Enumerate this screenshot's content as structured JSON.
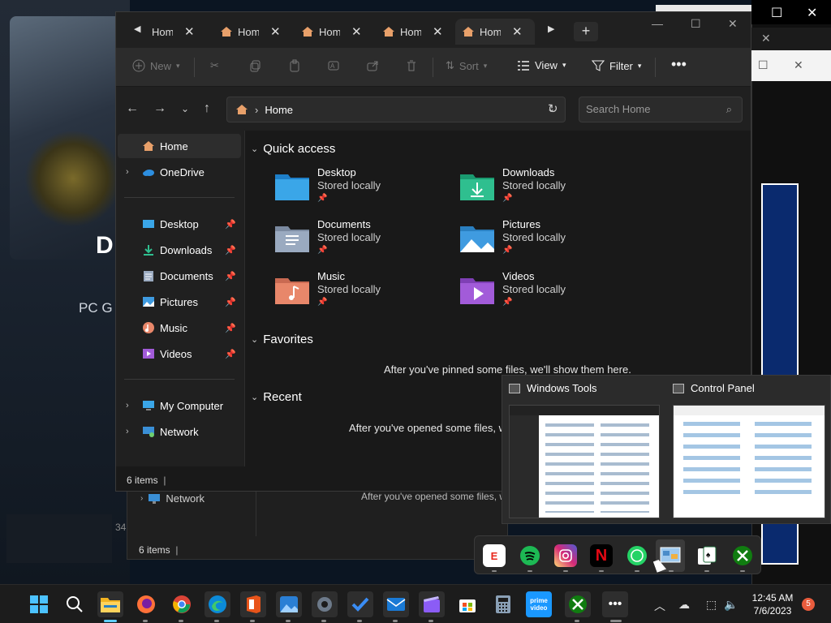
{
  "background": {
    "hero_letter": "D",
    "hero_subtitle": "PC G",
    "hero_counter": "34",
    "ghost_nav_item": "Network",
    "ghost_empty_msg": "After you've opened some files, w",
    "ghost_status": "6 items"
  },
  "explorer": {
    "tabs": [
      {
        "label": "Hom",
        "active": false
      },
      {
        "label": "Hom",
        "active": false
      },
      {
        "label": "Hom",
        "active": false
      },
      {
        "label": "Hom",
        "active": false
      },
      {
        "label": "Hom",
        "active": true
      }
    ],
    "toolbar": {
      "new_label": "New",
      "sort_label": "Sort",
      "view_label": "View",
      "filter_label": "Filter"
    },
    "address": {
      "path": "Home",
      "search_placeholder": "Search Home"
    },
    "sidebar": {
      "home": "Home",
      "onedrive": "OneDrive",
      "pinned": [
        {
          "label": "Desktop",
          "icon": "desktop-icon"
        },
        {
          "label": "Downloads",
          "icon": "download-icon"
        },
        {
          "label": "Documents",
          "icon": "documents-icon"
        },
        {
          "label": "Pictures",
          "icon": "pictures-icon"
        },
        {
          "label": "Music",
          "icon": "music-icon"
        },
        {
          "label": "Videos",
          "icon": "videos-icon"
        }
      ],
      "my_computer": "My Computer",
      "network": "Network"
    },
    "content": {
      "quick_access_title": "Quick access",
      "quick_access": [
        {
          "name": "Desktop",
          "sub": "Stored locally",
          "color": "#3aa6e8"
        },
        {
          "name": "Downloads",
          "sub": "Stored locally",
          "color": "#2fbf8f"
        },
        {
          "name": "Documents",
          "sub": "Stored locally",
          "color": "#9aaac0"
        },
        {
          "name": "Pictures",
          "sub": "Stored locally",
          "color": "#3f9be0"
        },
        {
          "name": "Music",
          "sub": "Stored locally",
          "color": "#e8876a"
        },
        {
          "name": "Videos",
          "sub": "Stored locally",
          "color": "#a25bd9"
        }
      ],
      "favorites_title": "Favorites",
      "favorites_empty": "After you've pinned some files, we'll show them here.",
      "recent_title": "Recent",
      "recent_empty": "After you've opened some files, we'"
    },
    "status": "6 items"
  },
  "previews": [
    {
      "title": "Windows Tools"
    },
    {
      "title": "Control Panel"
    }
  ],
  "overflow_apps": [
    {
      "name": "ESPN",
      "icon": "espn-icon",
      "glyph": "E",
      "color": "#e8271c"
    },
    {
      "name": "Spotify",
      "icon": "spotify-icon",
      "glyph": "",
      "color": "#1db954"
    },
    {
      "name": "Instagram",
      "icon": "instagram-icon",
      "glyph": "",
      "color": "#d62976"
    },
    {
      "name": "Netflix",
      "icon": "netflix-icon",
      "glyph": "N",
      "color": "#e50914"
    },
    {
      "name": "WhatsApp",
      "icon": "whatsapp-icon",
      "glyph": "",
      "color": "#25d366"
    },
    {
      "name": "Control Panel",
      "icon": "control-panel-icon",
      "glyph": "",
      "color": "#4a8cc9"
    },
    {
      "name": "Solitaire",
      "icon": "solitaire-icon",
      "glyph": "",
      "color": "#1f6b3a"
    },
    {
      "name": "Xbox",
      "icon": "xbox-icon",
      "glyph": "",
      "color": "#107c10"
    }
  ],
  "taskbar": {
    "time": "12:45 AM",
    "date": "7/6/2023",
    "notification_count": "5",
    "apps": [
      {
        "name": "Start",
        "icon": "windows-start-icon"
      },
      {
        "name": "Search",
        "icon": "search-icon"
      },
      {
        "name": "File Explorer",
        "icon": "file-explorer-icon"
      },
      {
        "name": "Firefox",
        "icon": "firefox-icon"
      },
      {
        "name": "Chrome",
        "icon": "chrome-icon"
      },
      {
        "name": "Edge",
        "icon": "edge-icon"
      },
      {
        "name": "Office",
        "icon": "office-icon"
      },
      {
        "name": "Photos",
        "icon": "photos-icon"
      },
      {
        "name": "Settings",
        "icon": "settings-icon"
      },
      {
        "name": "To Do",
        "icon": "todo-icon"
      },
      {
        "name": "Mail",
        "icon": "mail-icon"
      },
      {
        "name": "Clipchamp",
        "icon": "clipchamp-icon"
      },
      {
        "name": "Microsoft Store",
        "icon": "store-icon"
      },
      {
        "name": "Calculator",
        "icon": "calculator-icon"
      },
      {
        "name": "Prime Video",
        "icon": "prime-video-icon",
        "label": "prime video"
      },
      {
        "name": "Xbox",
        "icon": "xbox-icon"
      },
      {
        "name": "More",
        "icon": "more-icon"
      }
    ]
  }
}
